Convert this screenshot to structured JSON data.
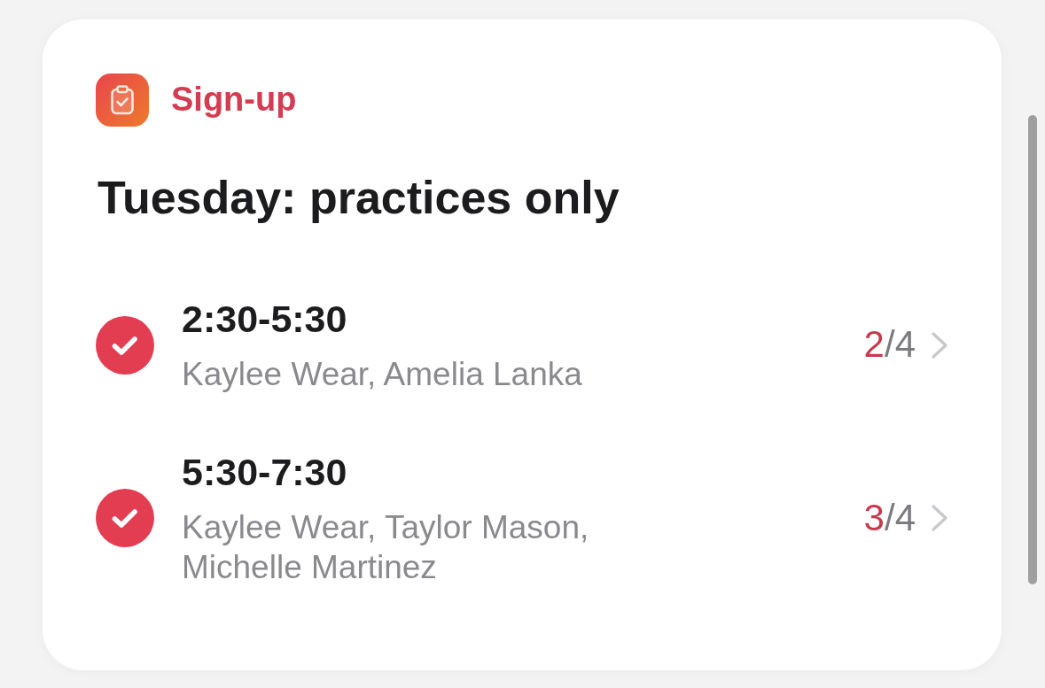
{
  "header": {
    "title": "Sign-up"
  },
  "heading": "Tuesday: practices only",
  "slots": [
    {
      "checked": true,
      "time": "2:30-5:30",
      "names": "Kaylee Wear, Amelia Lanka",
      "filled": "2",
      "capacity": "/4"
    },
    {
      "checked": true,
      "time": "5:30-7:30",
      "names": "Kaylee Wear, Taylor Mason, Michelle Martinez",
      "filled": "3",
      "capacity": "/4"
    }
  ]
}
